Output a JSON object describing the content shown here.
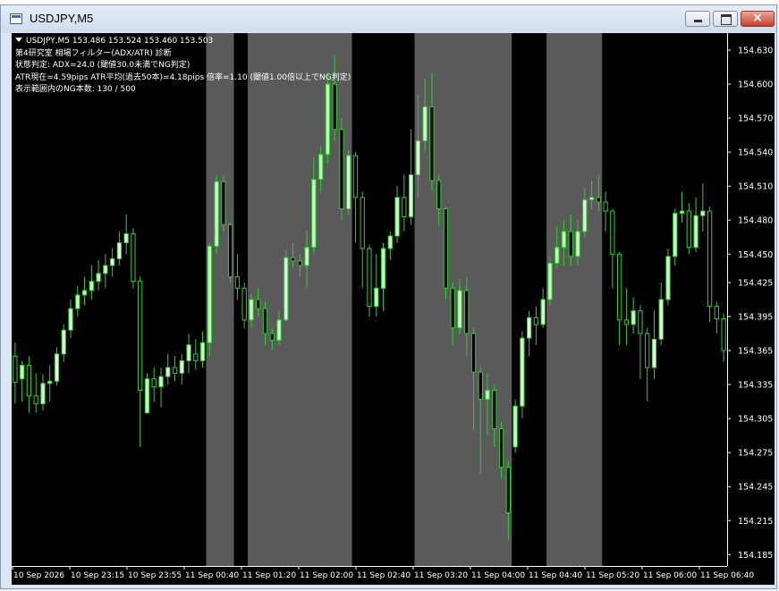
{
  "window": {
    "title": "USDJPY,M5"
  },
  "info": {
    "line1": "USDJPY,M5  153.486 153.524 153.460 153.503",
    "line2": "第4研究室 相場フィルター(ADX/ATR) 診断",
    "line3": "状態判定: ADX=24.0 (閾値30.0未満でNG判定)",
    "line4": "ATR現在=4.59pips  ATR平均(過去50本)=4.18pips  倍率=1.10 (閾値1.00倍以上でNG判定)",
    "line5": "表示範囲内のNG本数: 130 / 500"
  },
  "colors": {
    "background": "#000000",
    "ng_zone": "#5a5a5a",
    "bull_candle": "#ccffcc",
    "bear_candle": "#000000",
    "wick": "#33cc33",
    "axis": "#ffffff"
  },
  "chart_data": {
    "type": "candlestick",
    "symbol": "USDJPY",
    "timeframe": "M5",
    "ylim": [
      154.175,
      154.645
    ],
    "y_ticks": [
      "154.630",
      "154.600",
      "154.570",
      "154.540",
      "154.510",
      "154.480",
      "154.450",
      "154.425",
      "154.395",
      "154.365",
      "154.335",
      "154.305",
      "154.275",
      "154.245",
      "154.215",
      "154.185"
    ],
    "x_ticks": [
      "10 Sep 2026",
      "10 Sep 23:15",
      "10 Sep 23:55",
      "11 Sep 00:40",
      "11 Sep 01:20",
      "11 Sep 02:00",
      "11 Sep 02:40",
      "11 Sep 03:20",
      "11 Sep 04:00",
      "11 Sep 04:40",
      "11 Sep 05:20",
      "11 Sep 06:00",
      "11 Sep 06:40"
    ],
    "ng_zones": [
      [
        28,
        31
      ],
      [
        34,
        48
      ],
      [
        58,
        71
      ],
      [
        77,
        84
      ]
    ],
    "candles": [
      [
        154.36,
        154.337,
        154.372,
        154.318
      ],
      [
        154.34,
        154.352,
        154.356,
        154.32
      ],
      [
        154.352,
        154.325,
        154.36,
        154.31
      ],
      [
        154.325,
        154.318,
        154.345,
        154.31
      ],
      [
        154.318,
        154.336,
        154.344,
        154.312
      ],
      [
        154.336,
        154.338,
        154.352,
        154.32
      ],
      [
        154.338,
        154.362,
        154.368,
        154.334
      ],
      [
        154.362,
        154.383,
        154.388,
        154.355
      ],
      [
        154.383,
        154.402,
        154.41,
        154.376
      ],
      [
        154.402,
        154.414,
        154.422,
        154.395
      ],
      [
        154.414,
        154.418,
        154.43,
        154.405
      ],
      [
        154.418,
        154.426,
        154.44,
        154.41
      ],
      [
        154.426,
        154.433,
        154.445,
        154.418
      ],
      [
        154.433,
        154.44,
        154.45,
        154.42
      ],
      [
        154.44,
        154.446,
        154.455,
        154.43
      ],
      [
        154.446,
        154.46,
        154.47,
        154.44
      ],
      [
        154.46,
        154.468,
        154.485,
        154.45
      ],
      [
        154.468,
        154.426,
        154.473,
        154.42
      ],
      [
        154.426,
        154.33,
        154.43,
        154.28
      ],
      [
        154.31,
        154.34,
        154.345,
        154.31
      ],
      [
        154.34,
        154.333,
        154.35,
        154.32
      ],
      [
        154.333,
        154.342,
        154.35,
        154.315
      ],
      [
        154.342,
        154.35,
        154.362,
        154.335
      ],
      [
        154.35,
        154.345,
        154.36,
        154.338
      ],
      [
        154.345,
        154.356,
        154.362,
        154.335
      ],
      [
        154.356,
        154.37,
        154.38,
        154.345
      ],
      [
        154.362,
        154.356,
        154.375,
        154.348
      ],
      [
        154.356,
        154.372,
        154.382,
        154.35
      ],
      [
        154.372,
        154.457,
        154.46,
        154.36
      ],
      [
        154.457,
        154.514,
        154.52,
        154.45
      ],
      [
        154.514,
        154.476,
        154.52,
        154.47
      ],
      [
        154.476,
        154.43,
        154.478,
        154.425
      ],
      [
        154.43,
        154.42,
        154.45,
        154.41
      ],
      [
        154.42,
        154.392,
        154.425,
        154.385
      ],
      [
        154.392,
        154.41,
        154.415,
        154.385
      ],
      [
        154.41,
        154.402,
        154.42,
        154.395
      ],
      [
        154.402,
        154.38,
        154.408,
        154.37
      ],
      [
        154.38,
        154.374,
        154.385,
        154.365
      ],
      [
        154.374,
        154.392,
        154.4,
        154.37
      ],
      [
        154.392,
        154.447,
        154.454,
        154.39
      ],
      [
        154.447,
        154.444,
        154.46,
        154.438
      ],
      [
        154.444,
        154.44,
        154.45,
        154.43
      ],
      [
        154.44,
        154.456,
        154.47,
        154.42
      ],
      [
        154.456,
        154.516,
        154.535,
        154.45
      ],
      [
        154.516,
        154.538,
        154.545,
        154.505
      ],
      [
        154.538,
        154.6,
        154.61,
        154.53
      ],
      [
        154.6,
        154.56,
        154.625,
        154.55
      ],
      [
        154.56,
        154.49,
        154.57,
        154.48
      ],
      [
        154.49,
        154.537,
        154.542,
        154.485
      ],
      [
        154.537,
        154.5,
        154.54,
        154.46
      ],
      [
        154.5,
        154.455,
        154.505,
        154.42
      ],
      [
        154.455,
        154.404,
        154.458,
        154.395
      ],
      [
        154.404,
        154.42,
        154.45,
        154.395
      ],
      [
        154.42,
        154.455,
        154.46,
        154.4
      ],
      [
        154.455,
        154.466,
        154.47,
        154.445
      ],
      [
        154.466,
        154.5,
        154.51,
        154.46
      ],
      [
        154.5,
        154.483,
        154.52,
        154.47
      ],
      [
        154.483,
        154.52,
        154.56,
        154.476
      ],
      [
        154.52,
        154.55,
        154.59,
        154.5
      ],
      [
        154.55,
        154.58,
        154.605,
        154.54
      ],
      [
        154.58,
        154.515,
        154.61,
        154.505
      ],
      [
        154.515,
        154.49,
        154.52,
        154.475
      ],
      [
        154.49,
        154.42,
        154.492,
        154.41
      ],
      [
        154.42,
        154.385,
        154.425,
        154.37
      ],
      [
        154.385,
        154.418,
        154.428,
        154.38
      ],
      [
        154.418,
        154.38,
        154.43,
        154.36
      ],
      [
        154.38,
        154.346,
        154.385,
        154.295
      ],
      [
        154.346,
        154.322,
        154.35,
        154.256
      ],
      [
        154.322,
        154.33,
        154.345,
        154.29
      ],
      [
        154.33,
        154.296,
        154.335,
        154.28
      ],
      [
        154.296,
        154.262,
        154.302,
        154.252
      ],
      [
        154.262,
        154.222,
        154.268,
        154.198
      ],
      [
        154.28,
        154.316,
        154.322,
        154.275
      ],
      [
        154.316,
        154.376,
        154.382,
        154.305
      ],
      [
        154.376,
        154.394,
        154.4,
        154.36
      ],
      [
        154.394,
        154.388,
        154.404,
        154.37
      ],
      [
        154.388,
        154.41,
        154.42,
        154.385
      ],
      [
        154.41,
        154.442,
        154.448,
        154.405
      ],
      [
        154.442,
        154.456,
        154.475,
        154.438
      ],
      [
        154.456,
        154.47,
        154.48,
        154.44
      ],
      [
        154.47,
        154.448,
        154.485,
        154.44
      ],
      [
        154.448,
        154.47,
        154.48,
        154.44
      ],
      [
        154.47,
        154.498,
        154.508,
        154.465
      ],
      [
        154.498,
        154.5,
        154.515,
        154.49
      ],
      [
        154.5,
        154.496,
        154.52,
        154.488
      ],
      [
        154.496,
        154.488,
        154.505,
        154.47
      ],
      [
        154.488,
        154.45,
        154.49,
        154.42
      ],
      [
        154.45,
        154.392,
        154.452,
        154.37
      ],
      [
        154.392,
        154.388,
        154.42,
        154.37
      ],
      [
        154.388,
        154.4,
        154.412,
        154.38
      ],
      [
        154.4,
        154.38,
        154.405,
        154.34
      ],
      [
        154.38,
        154.35,
        154.385,
        154.32
      ],
      [
        154.35,
        154.375,
        154.4,
        154.34
      ],
      [
        154.375,
        154.41,
        154.425,
        154.37
      ],
      [
        154.41,
        154.448,
        154.455,
        154.405
      ],
      [
        154.448,
        154.486,
        154.49,
        154.44
      ],
      [
        154.486,
        154.488,
        154.505,
        154.478
      ],
      [
        154.488,
        154.456,
        154.495,
        154.45
      ],
      [
        154.456,
        154.484,
        154.5,
        154.452
      ],
      [
        154.484,
        154.488,
        154.512,
        154.47
      ],
      [
        154.488,
        154.404,
        154.492,
        154.39
      ],
      [
        154.404,
        154.393,
        154.408,
        154.38
      ],
      [
        154.393,
        154.365,
        154.398,
        154.355
      ]
    ]
  }
}
